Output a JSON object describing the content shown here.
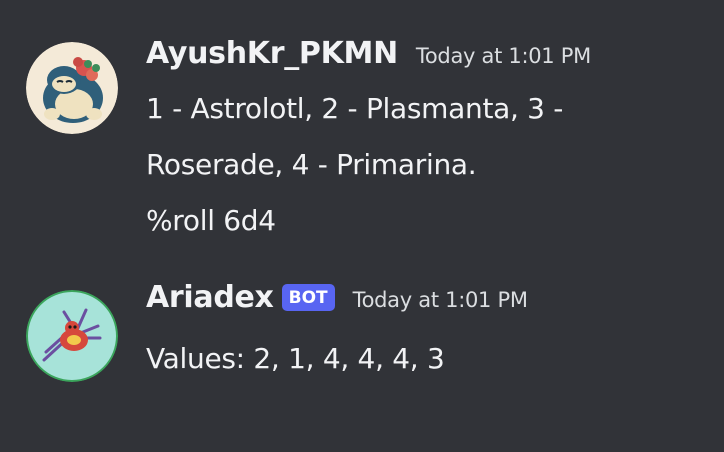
{
  "messages": [
    {
      "username": "AyushKr_PKMN",
      "timestamp": "Today at 1:01 PM",
      "avatar_icon": "snorlax-avatar-icon",
      "lines": [
        "1 - Astrolotl, 2 - Plasmanta, 3 -",
        "Roserade, 4 - Primarina.",
        "%roll 6d4"
      ]
    },
    {
      "username": "Ariadex",
      "badge": "BOT",
      "timestamp": "Today at 1:01 PM",
      "avatar_icon": "ariados-avatar-icon",
      "lines": [
        "Values: 2, 1, 4, 4, 4, 3"
      ]
    }
  ],
  "colors": {
    "background": "#313338",
    "username": "#f2f3f5",
    "text": "#f2f3f5",
    "timestamp": "#dbdee1",
    "bot_badge": "#5865f2",
    "bot_avatar_ring": "#3ba55c"
  }
}
